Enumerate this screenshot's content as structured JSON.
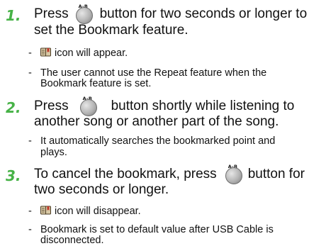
{
  "step1": {
    "number": "1.",
    "press": "Press",
    "button_label": "A-B",
    "main_rest": "button for two seconds or longer to",
    "main_line2": "set the Bookmark feature.",
    "bullet1": "icon will appear.",
    "bullet2_line1": "The user cannot use the Repeat feature when the",
    "bullet2_line2": "Bookmark feature is set."
  },
  "step2": {
    "number": "2.",
    "press": "Press",
    "button_label": "A-B",
    "main_rest": "button shortly while listening to",
    "main_line2": "another song or another part of the song.",
    "bullet1_line1": "It automatically searches the bookmarked point and",
    "bullet1_line2": "plays."
  },
  "step3": {
    "number": "3.",
    "main_line1": "To cancel the bookmark, press",
    "button_label": "A-B",
    "main_rest": "button for",
    "main_line2": "two seconds or longer.",
    "bullet1": "icon will disappear.",
    "bullet2_line1": "Bookmark is set to default value after USB Cable is",
    "bullet2_line2": "disconnected."
  },
  "bullet_dash": "-",
  "icons": {
    "ab_button": "ab-button-icon",
    "bookmark": "bookmark-icon"
  },
  "colors": {
    "step_number": "#46b246"
  }
}
